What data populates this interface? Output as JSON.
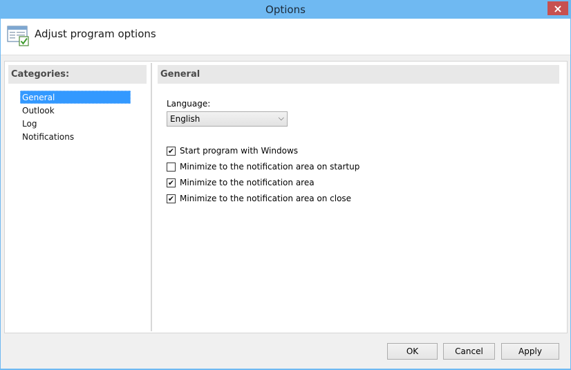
{
  "window": {
    "title": "Options",
    "close_glyph": "×"
  },
  "header": {
    "title": "Adjust program options",
    "icon": "options-window-icon"
  },
  "categories": {
    "heading": "Categories:",
    "items": [
      {
        "label": "General",
        "selected": true
      },
      {
        "label": "Outlook",
        "selected": false
      },
      {
        "label": "Log",
        "selected": false
      },
      {
        "label": "Notifications",
        "selected": false
      }
    ]
  },
  "general": {
    "heading": "General",
    "language_label": "Language:",
    "language_value": "English",
    "checkboxes": [
      {
        "label": "Start program with Windows",
        "checked": true
      },
      {
        "label": "Minimize to the notification area on startup",
        "checked": false
      },
      {
        "label": "Minimize to the notification area",
        "checked": true
      },
      {
        "label": "Minimize to the notification area on close",
        "checked": true
      }
    ]
  },
  "buttons": {
    "ok": "OK",
    "cancel": "Cancel",
    "apply": "Apply"
  },
  "colors": {
    "titlebar": "#6fb9f2",
    "selection": "#3399ff",
    "close": "#c75050"
  }
}
